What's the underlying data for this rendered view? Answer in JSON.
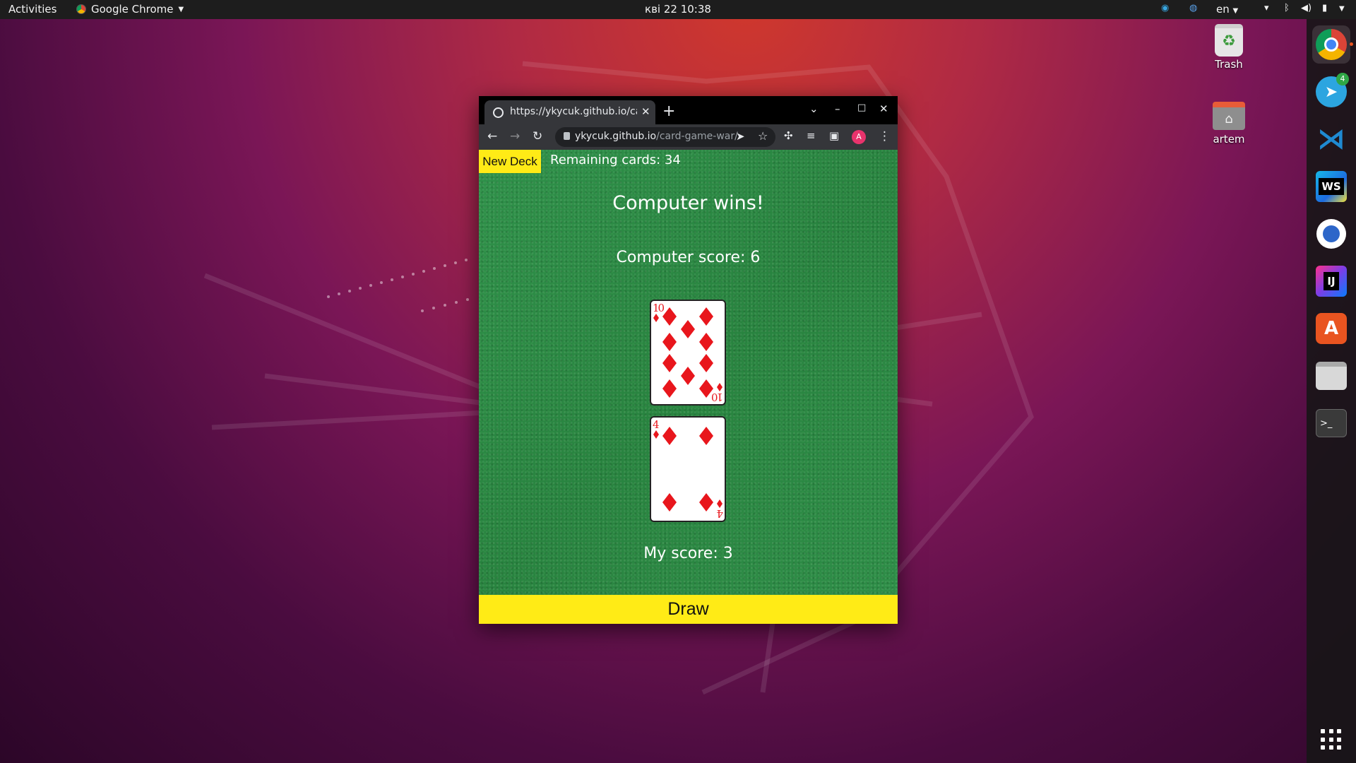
{
  "topbar": {
    "activities": "Activities",
    "app_name": "Google Chrome",
    "clock": "кві 22  10:38",
    "language": "en"
  },
  "desktop": {
    "trash_label": "Trash",
    "home_label": "artem"
  },
  "dock": {
    "telegram_badge": "4",
    "webstorm_label": "WS",
    "intellij_label": "IJ",
    "terminal_label": ">_"
  },
  "browser": {
    "tab_title": "https://ykycuk.github.io/card-game-war/",
    "url_host": "ykycuk.github.io",
    "url_path": "/card-game-war/",
    "avatar_letter": "A"
  },
  "page": {
    "new_deck_label": "New Deck",
    "remaining_cards": "Remaining cards: 34",
    "result": "Computer wins!",
    "computer_score": "Computer score: 6",
    "my_score": "My score: 3",
    "draw_label": "Draw",
    "computer_card": {
      "rank": "10",
      "suit": "diamonds"
    },
    "player_card": {
      "rank": "4",
      "suit": "diamonds"
    },
    "suit_color": "#e8161c",
    "button_color": "#ffeb16"
  }
}
